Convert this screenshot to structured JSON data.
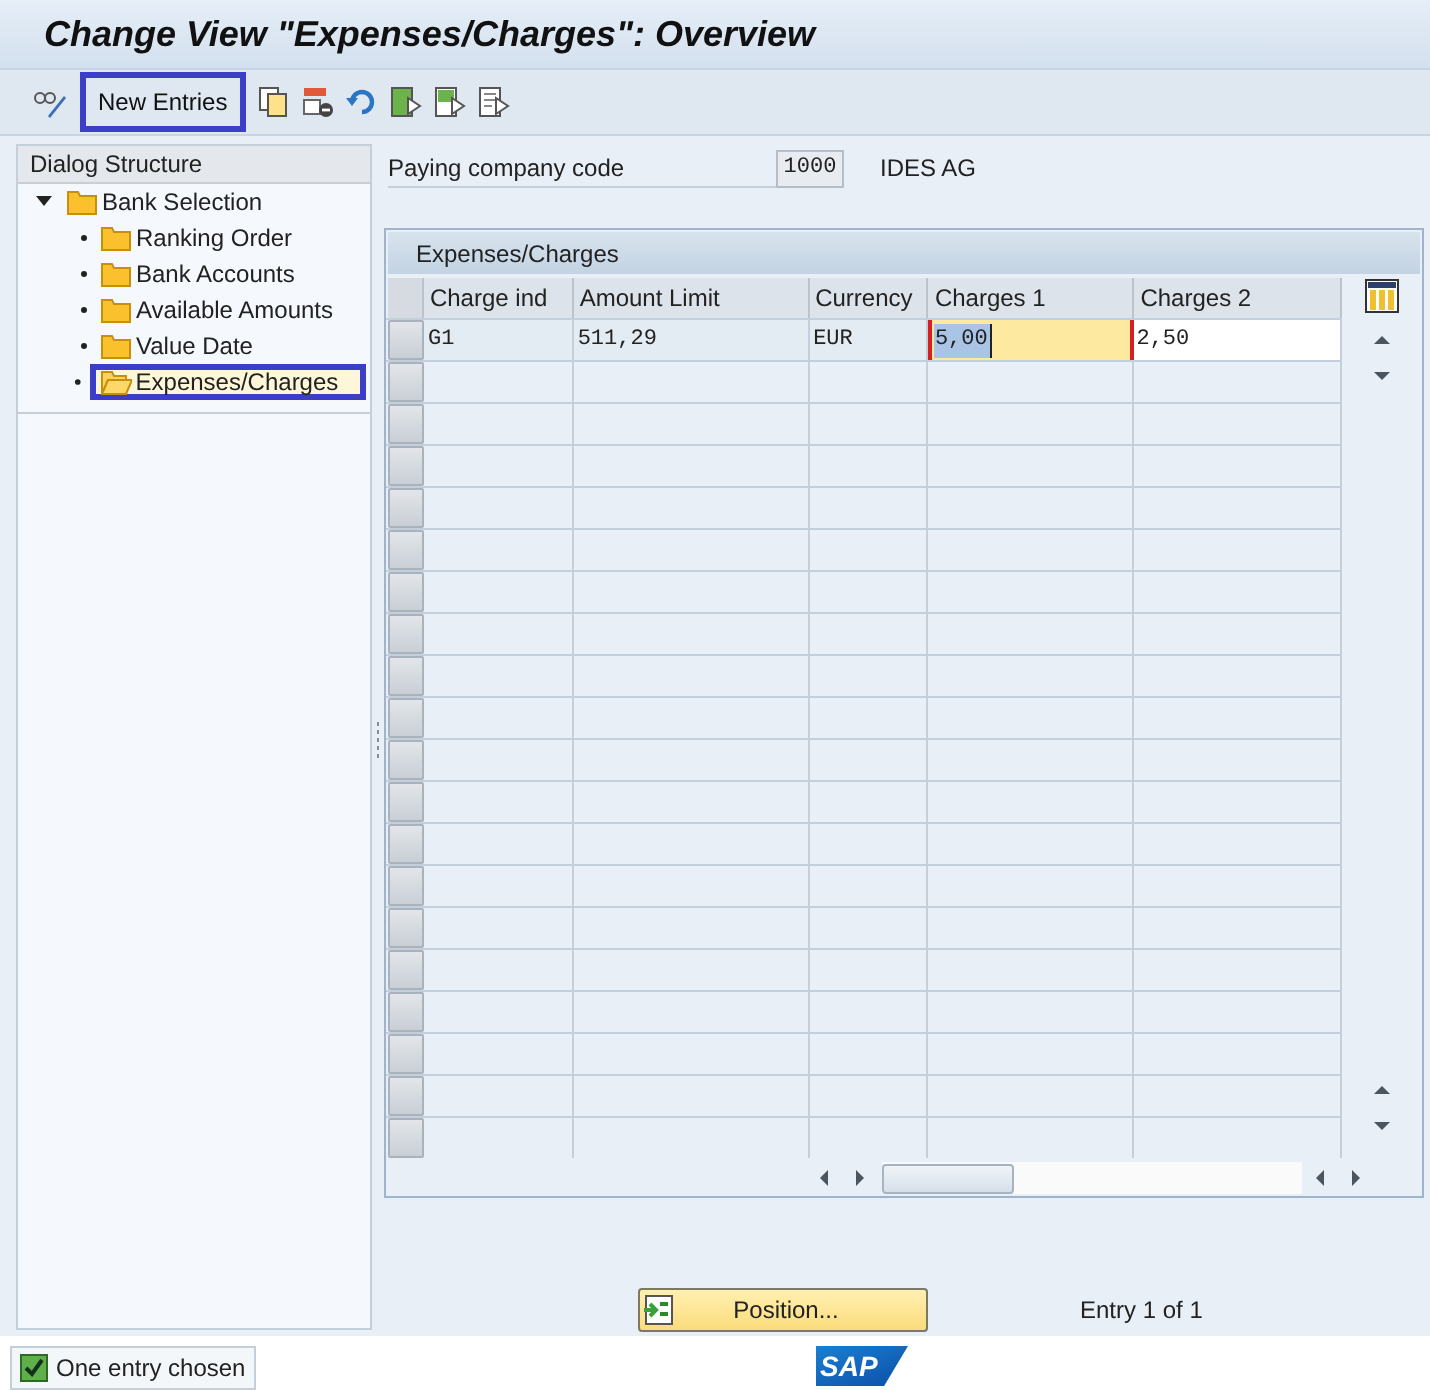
{
  "window": {
    "title": "Change View \"Expenses/Charges\": Overview"
  },
  "toolbar": {
    "new_entries_button": "New Entries"
  },
  "dialog_structure": {
    "title": "Dialog Structure",
    "tree": [
      {
        "label": "Bank Selection",
        "expanded": true,
        "selected": false,
        "children": [
          {
            "label": "Ranking Order",
            "selected": false
          },
          {
            "label": "Bank Accounts",
            "selected": false
          },
          {
            "label": "Available Amounts",
            "selected": false
          },
          {
            "label": "Value Date",
            "selected": false
          },
          {
            "label": "Expenses/Charges",
            "selected": true
          }
        ]
      }
    ]
  },
  "header_field": {
    "label": "Paying company code",
    "value": "1000",
    "description": "IDES AG"
  },
  "table": {
    "title": "Expenses/Charges",
    "columns": [
      "Charge ind",
      "Amount Limit",
      "Currency",
      "Charges 1",
      "Charges 2"
    ],
    "rows": [
      {
        "cells": [
          {
            "text": "G1",
            "editable": false,
            "focused": false
          },
          {
            "text": "511,29",
            "editable": false,
            "focused": false
          },
          {
            "text": "EUR",
            "editable": false,
            "focused": false
          },
          {
            "text": "5,00",
            "editable": true,
            "focused": true
          },
          {
            "text": "2,50",
            "editable": true,
            "focused": false
          }
        ]
      }
    ]
  },
  "position_button": "Position...",
  "entry_count": "Entry 1 of 1",
  "status_bar": {
    "message": "One entry chosen",
    "kind": "success"
  },
  "logo": "SAP"
}
